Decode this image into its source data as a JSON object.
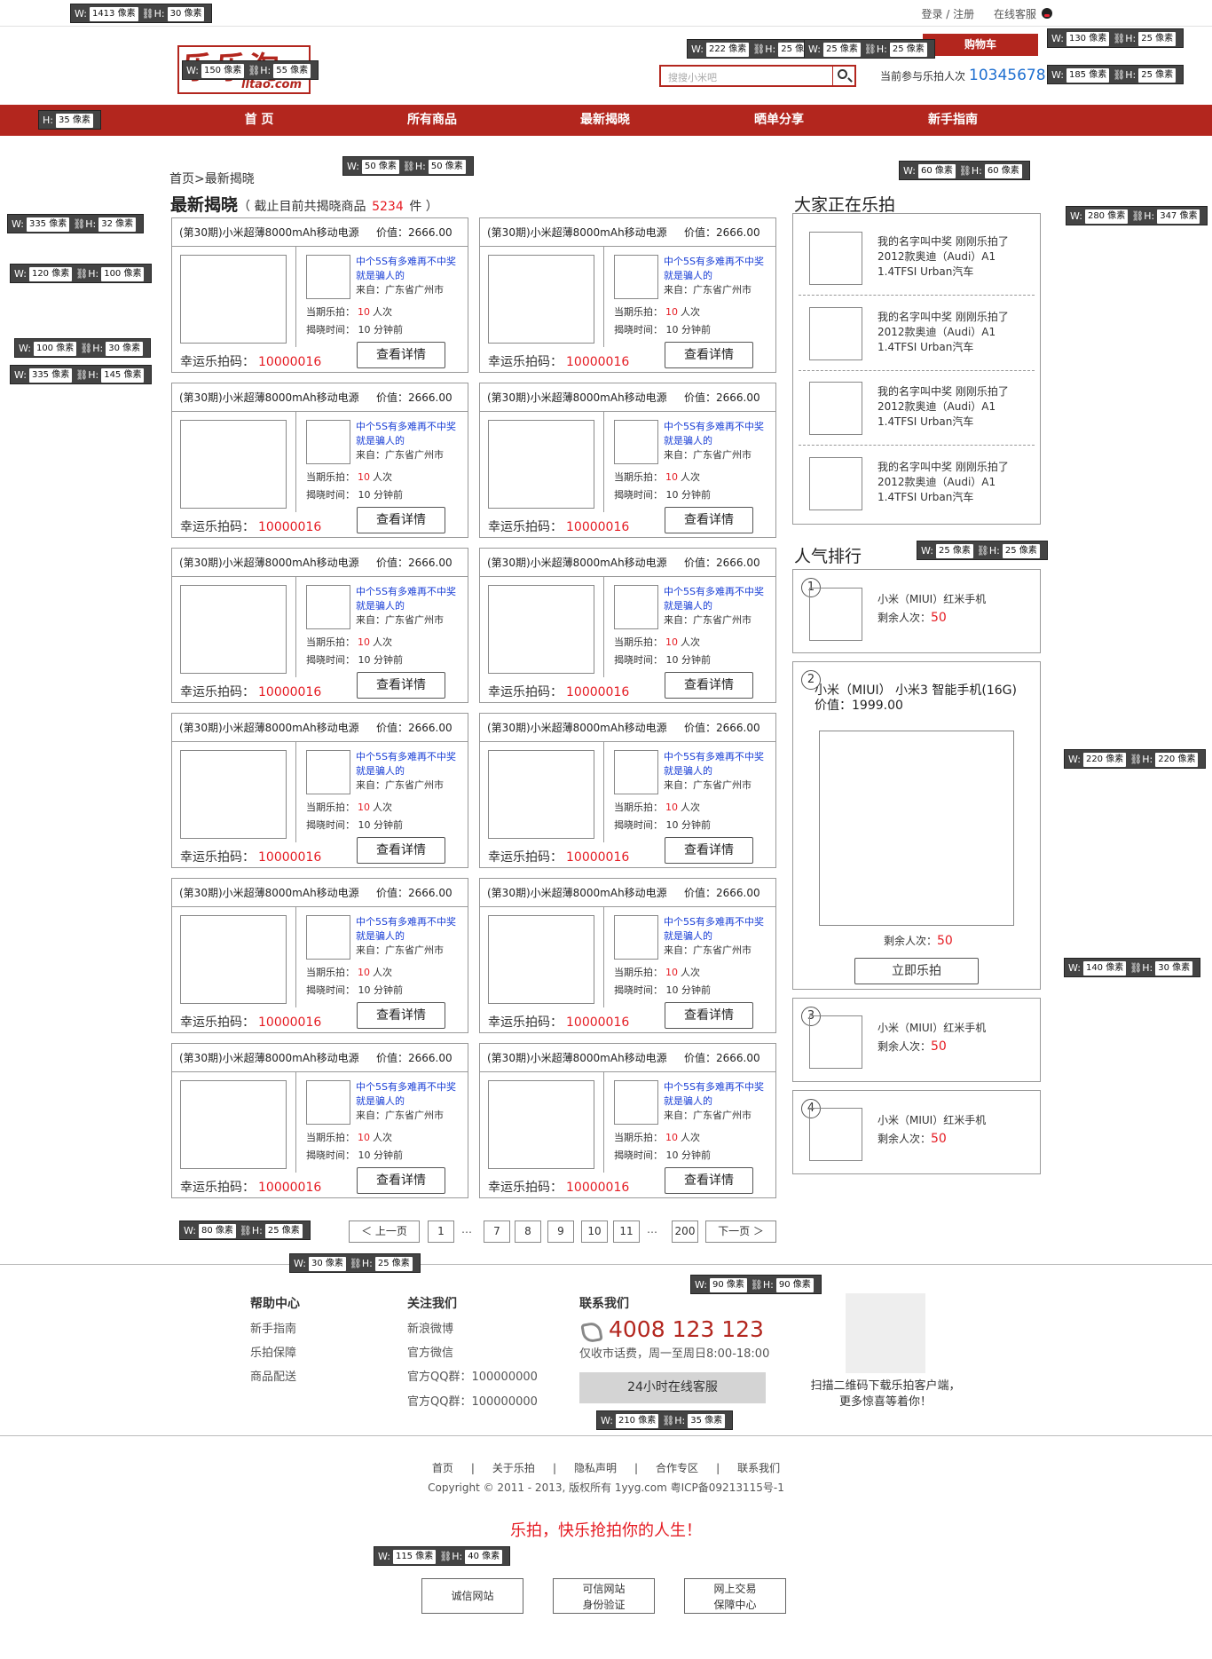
{
  "top_bar": {
    "login": "登录 / 注册",
    "service": "在线客服",
    "service_icon": "qq-icon"
  },
  "logo": {
    "text": "乐乐淘",
    "domain": "lltao.com"
  },
  "search": {
    "placeholder": "搜搜小米吧",
    "icon": "search-icon"
  },
  "cart": {
    "label": "购物车"
  },
  "participants": {
    "label": "当前参与乐拍人次",
    "count": "10345678"
  },
  "nav": {
    "items": [
      "首 页",
      "所有商品",
      "最新揭晓",
      "晒单分享",
      "新手指南"
    ]
  },
  "breadcrumb": "首页>最新揭晓",
  "heading": {
    "title": "最新揭晓",
    "prefix": "（ 截止目前共揭晓商品",
    "count": "5234",
    "suffix": "件 ）"
  },
  "card": {
    "title": "(第30期)小米超薄8000mAh移动电源",
    "price": "价值：2666.00",
    "desc": "中个5S有多难再不中奖就是骗人的",
    "from": "来自：广东省广州市",
    "current_label": "当期乐拍：",
    "current_value": "10",
    "current_unit": "人次",
    "time_label": "揭晓时间：",
    "time_value": "10 分钟前",
    "lucky_label": "幸运乐拍码：",
    "lucky_code": "10000016",
    "detail_button": "查看详情"
  },
  "sidebar": {
    "live_title": "大家正在乐拍",
    "live_items": [
      {
        "line1": "我的名字叫中奖  刚刚乐拍了",
        "line2": "2012款奥迪（Audi）A1",
        "line3": "1.4TFSI Urban汽车"
      },
      {
        "line1": "我的名字叫中奖  刚刚乐拍了",
        "line2": "2012款奥迪（Audi）A1",
        "line3": "1.4TFSI Urban汽车"
      },
      {
        "line1": "我的名字叫中奖  刚刚乐拍了",
        "line2": "2012款奥迪（Audi）A1",
        "line3": "1.4TFSI Urban汽车"
      },
      {
        "line1": "我的名字叫中奖  刚刚乐拍了",
        "line2": "2012款奥迪（Audi）A1",
        "line3": "1.4TFSI Urban汽车"
      }
    ],
    "rank_title": "人气排行",
    "rank_items": [
      {
        "rank": "1",
        "name": "小米（MIUI）红米手机",
        "remain_label": "剩余人次：",
        "remain": "50"
      },
      {
        "rank": "2",
        "name": "小米（MIUI） 小米3 智能手机(16G)",
        "price": "价值：1999.00",
        "remain_label": "剩余人次：",
        "remain": "50",
        "button": "立即乐拍"
      },
      {
        "rank": "3",
        "name": "小米（MIUI）红米手机",
        "remain_label": "剩余人次：",
        "remain": "50"
      },
      {
        "rank": "4",
        "name": "小米（MIUI）红米手机",
        "remain_label": "剩余人次：",
        "remain": "50"
      }
    ]
  },
  "pagination": {
    "prev": "＜  上一页",
    "pages": [
      "1",
      "7",
      "8",
      "9",
      "10",
      "11",
      "200"
    ],
    "dots": "…",
    "next": "下一页  ＞"
  },
  "footer": {
    "help": {
      "title": "帮助中心",
      "links": [
        "新手指南",
        "乐拍保障",
        "商品配送"
      ]
    },
    "follow": {
      "title": "关注我们",
      "links": [
        "新浪微博",
        "官方微信",
        "官方QQ群：100000000",
        "官方QQ群：100000000"
      ]
    },
    "contact": {
      "title": "联系我们",
      "phone": "4008 123 123",
      "hours": "仅收市话费，周一至周日8:00-18:00",
      "online_button": "24小时在线客服"
    },
    "qr_text": "扫描二维码下载乐拍客户端，更多惊喜等着你！",
    "bottom_links": [
      "首页",
      "|",
      "关于乐拍",
      "|",
      "隐私声明",
      "|",
      "合作专区",
      "|",
      "联系我们"
    ],
    "copyright": "Copyright © 2011 - 2013, 版权所有 1yyg.com 粤ICP备09213115号-1",
    "slogan": "乐拍，快乐抢拍你的人生！",
    "badges": [
      {
        "line1": "诚信网站",
        "line2": ""
      },
      {
        "line1": "可信网站",
        "line2": "身份验证"
      },
      {
        "line1": "网上交易",
        "line2": "保障中心"
      }
    ]
  },
  "dimension_labels": {
    "w_prefix": "W:",
    "h_prefix": "H:",
    "page": {
      "w": "1413 像素",
      "h": "30 像素"
    },
    "logo": {
      "w": "150 像素",
      "h": "55 像素"
    },
    "search": {
      "w": "222 像素",
      "h": "25 像素"
    },
    "search_btn": {
      "w": "25 像素",
      "h": "25 像素"
    },
    "cart": {
      "w": "130 像素",
      "h": "25 像素"
    },
    "count": {
      "w": "185 像素",
      "h": "25 像素"
    },
    "nav": {
      "h": "35 像素"
    },
    "thumb": {
      "w": "50 像素",
      "h": "50 像素"
    },
    "card_head": {
      "w": "335 像素",
      "h": "32 像素"
    },
    "card_pic": {
      "w": "120 像素",
      "h": "100 像素"
    },
    "detail_btn": {
      "w": "100 像素",
      "h": "30 像素"
    },
    "card": {
      "w": "335 像素",
      "h": "145 像素"
    },
    "live_pic": {
      "w": "60 像素",
      "h": "60 像素"
    },
    "live_box": {
      "w": "280 像素",
      "h": "347 像素"
    },
    "rank_circle": {
      "w": "25 像素",
      "h": "25 像素"
    },
    "rank_pic": {
      "w": "220 像素",
      "h": "220 像素"
    },
    "rank_btn": {
      "w": "140 像素",
      "h": "30 像素"
    },
    "pg_btn": {
      "w": "80 像素",
      "h": "25 像素"
    },
    "pg_num": {
      "w": "30 像素",
      "h": "25 像素"
    },
    "qr": {
      "w": "90 像素",
      "h": "90 像素"
    },
    "online_btn": {
      "w": "210 像素",
      "h": "35 像素"
    },
    "badge": {
      "w": "115 像素",
      "h": "40 像素"
    }
  }
}
